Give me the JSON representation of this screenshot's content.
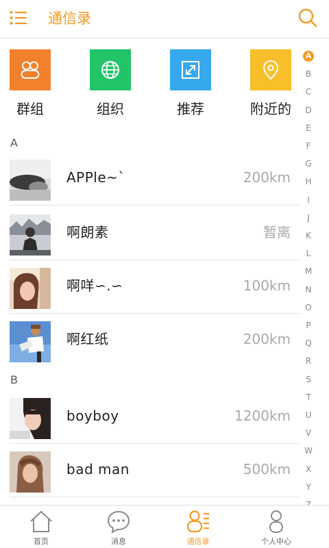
{
  "header": {
    "title": "通信录"
  },
  "colors": {
    "accent": "#f39a24"
  },
  "tiles": [
    {
      "label": "群组",
      "icon": "group-icon",
      "color": "#f2802d"
    },
    {
      "label": "组织",
      "icon": "globe-icon",
      "color": "#22c468"
    },
    {
      "label": "推荐",
      "icon": "expand-icon",
      "color": "#36a9ee"
    },
    {
      "label": "附近的",
      "icon": "location-pin-icon",
      "color": "#f8bf2a"
    }
  ],
  "sections": [
    {
      "letter": "A",
      "contacts": [
        {
          "name": "APPle~`",
          "distance": "200km"
        },
        {
          "name": "啊朗素",
          "distance": "暂离"
        },
        {
          "name": "啊咩∽.∽",
          "distance": "100km"
        },
        {
          "name": "啊红纸",
          "distance": "200km"
        }
      ]
    },
    {
      "letter": "B",
      "contacts": [
        {
          "name": "boyboy",
          "distance": "1200km"
        },
        {
          "name": "bad man",
          "distance": "500km"
        }
      ]
    }
  ],
  "index": [
    "A",
    "B",
    "C",
    "D",
    "E",
    "F",
    "G",
    "H",
    "I",
    "J",
    "K",
    "L",
    "M",
    "N",
    "O",
    "P",
    "Q",
    "R",
    "S",
    "T",
    "U",
    "V",
    "W",
    "X",
    "Y",
    "Z"
  ],
  "index_active": "A",
  "nav": [
    {
      "label": "首页",
      "icon": "home-icon",
      "active": false
    },
    {
      "label": "消息",
      "icon": "message-icon",
      "active": false
    },
    {
      "label": "通信录",
      "icon": "contacts-icon",
      "active": true
    },
    {
      "label": "个人中心",
      "icon": "person-icon",
      "active": false
    }
  ]
}
